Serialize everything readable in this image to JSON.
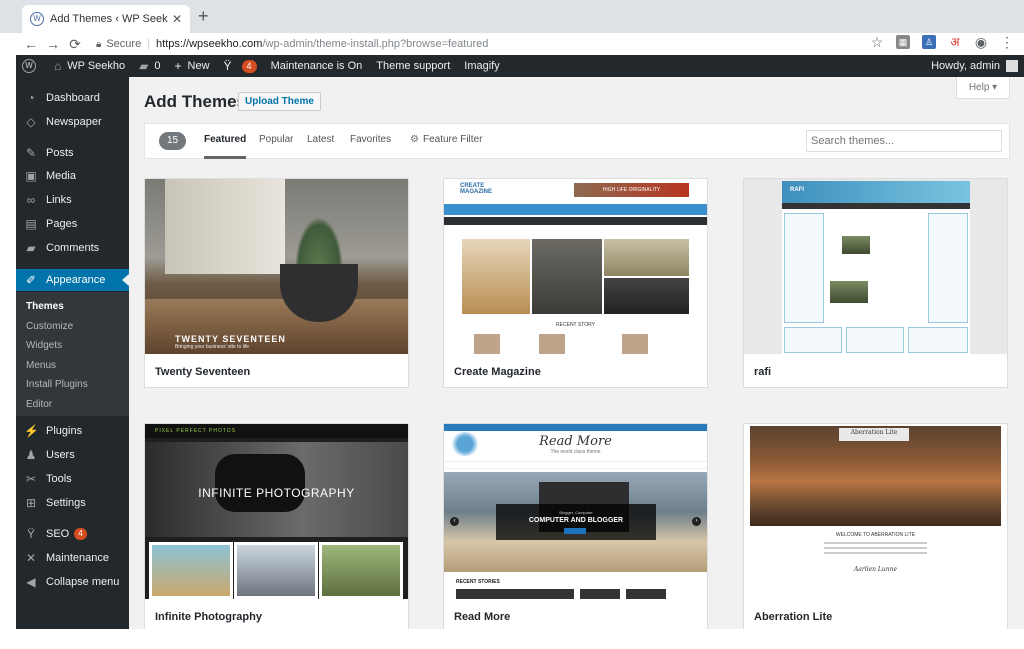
{
  "browser": {
    "tab_title": "Add Themes ‹ WP Seekho — W",
    "tab_close": "✕",
    "new_tab": "+",
    "secure_label": "Secure",
    "url_host": "https://wpseekho.com",
    "url_path": "/wp-admin/theme-install.php?browse=featured"
  },
  "admin_bar": {
    "site_name": "WP Seekho",
    "comments_count": "0",
    "new_label": "New",
    "yoast_count": "4",
    "maintenance": "Maintenance is On",
    "theme_support": "Theme support",
    "imagify": "Imagify",
    "howdy": "Howdy, admin"
  },
  "sidebar": {
    "items": [
      {
        "label": "Dashboard",
        "icon": "dashboard-icon"
      },
      {
        "label": "Newspaper",
        "icon": "newspaper-icon"
      },
      {
        "label": "Posts",
        "icon": "pin-icon"
      },
      {
        "label": "Media",
        "icon": "media-icon"
      },
      {
        "label": "Links",
        "icon": "link-icon"
      },
      {
        "label": "Pages",
        "icon": "pages-icon"
      },
      {
        "label": "Comments",
        "icon": "comment-icon"
      },
      {
        "label": "Appearance",
        "icon": "brush-icon"
      },
      {
        "label": "Plugins",
        "icon": "plug-icon"
      },
      {
        "label": "Users",
        "icon": "users-icon"
      },
      {
        "label": "Tools",
        "icon": "wrench-icon"
      },
      {
        "label": "Settings",
        "icon": "settings-icon"
      },
      {
        "label": "SEO",
        "icon": "yoast-icon",
        "badge": "4"
      },
      {
        "label": "Maintenance",
        "icon": "maintenance-icon"
      },
      {
        "label": "Collapse menu",
        "icon": "collapse-icon"
      }
    ],
    "appearance_submenu": [
      "Themes",
      "Customize",
      "Widgets",
      "Menus",
      "Install Plugins",
      "Editor"
    ]
  },
  "main": {
    "title": "Add Themes",
    "upload_button": "Upload Theme",
    "help": "Help ▾",
    "filter": {
      "count": "15",
      "tabs": [
        "Featured",
        "Popular",
        "Latest",
        "Favorites"
      ],
      "feature_filter": "Feature Filter",
      "search_placeholder": "Search themes..."
    },
    "themes": [
      {
        "name": "Twenty Seventeen",
        "shot_title": "TWENTY SEVENTEEN",
        "shot_sub": "Bringing your business' site to life"
      },
      {
        "name": "Create Magazine",
        "shot_logo": "CREATE MAGAZINE",
        "shot_ad": "HIGH LIFE ORIGINALITY",
        "shot_recent": "RECENT STORY"
      },
      {
        "name": "rafi",
        "shot_title": "RAFI"
      },
      {
        "name": "Infinite Photography",
        "shot_logo": "PIXEL PERFECT PHOTOS",
        "shot_title": "INFINITE PHOTOGRAPHY"
      },
      {
        "name": "Read More",
        "shot_brand": "Read More",
        "shot_tagline": "The world class theme",
        "shot_kicker": "Blogger, Computer",
        "shot_title": "COMPUTER AND BLOGGER",
        "shot_recent": "RECENT STORIES"
      },
      {
        "name": "Aberration Lite",
        "shot_brand": "Aberration Lite",
        "shot_welcome": "WELCOME TO ABERRATION LITE",
        "shot_sig": "Aarlien Lunne"
      }
    ]
  }
}
